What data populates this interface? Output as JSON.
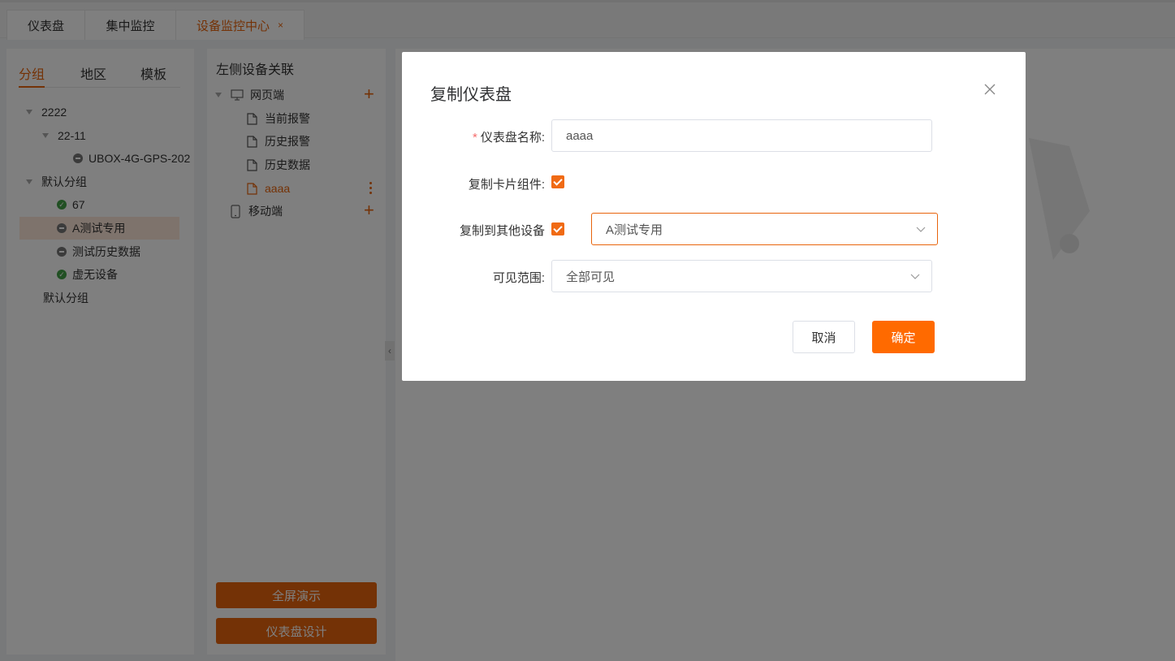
{
  "tabs": [
    {
      "label": "仪表盘"
    },
    {
      "label": "集中监控"
    },
    {
      "label": "设备监控中心",
      "close": "×"
    }
  ],
  "left_panel": {
    "tabs": [
      "分组",
      "地区",
      "模板"
    ],
    "tree": {
      "n1": "2222",
      "n2": "22-11",
      "n3": "UBOX-4G-GPS-202",
      "n4": "默认分组",
      "n5": "67",
      "n6": "A测试专用",
      "n7": "测试历史数据",
      "n8": "虚无设备",
      "n9": "默认分组"
    }
  },
  "mid_panel": {
    "title": "左侧设备关联",
    "web": "网页端",
    "pages": [
      "当前报警",
      "历史报警",
      "历史数据",
      "aaaa"
    ],
    "mobile": "移动端",
    "btn_fullscreen": "全屏演示",
    "btn_design": "仪表盘设计"
  },
  "dialog": {
    "title": "复制仪表盘",
    "required_mark": "*",
    "name_label": "仪表盘名称:",
    "name_value": "aaaa",
    "copy_cards_label": "复制卡片组件:",
    "copy_cards_checked": true,
    "copy_devices_label": "复制到其他设备",
    "copy_devices_checked": true,
    "device_value": "A测试专用",
    "visible_label": "可见范围:",
    "visible_value": "全部可见",
    "cancel": "取消",
    "confirm": "确定"
  },
  "colors": {
    "accent": "#e8640c",
    "confirm": "#ff6a00",
    "checkbox": "#f06a14"
  },
  "icons": [
    "close-icon",
    "monitor-icon",
    "phone-icon",
    "file-icon",
    "plus-icon",
    "more-icon",
    "chevron-down-icon",
    "chevron-left-icon",
    "caret-down-icon",
    "status-offline-icon",
    "status-online-icon"
  ]
}
